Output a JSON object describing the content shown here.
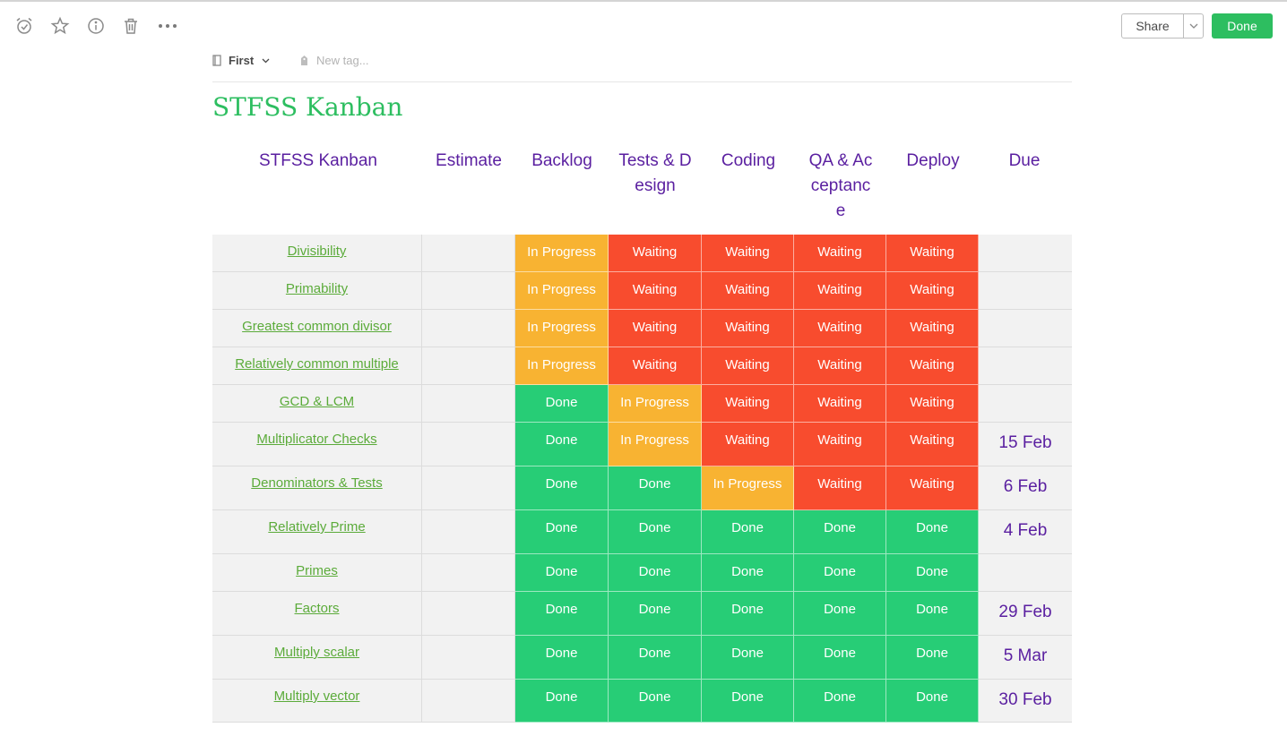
{
  "colors": {
    "in_progress": "#f8b332",
    "waiting": "#f84c2e",
    "done": "#27cd76"
  },
  "toolbar": {
    "icons": [
      "reminder-icon",
      "star-icon",
      "info-icon",
      "trash-icon",
      "more-icon"
    ],
    "share_label": "Share",
    "done_label": "Done"
  },
  "note": {
    "notebook": "First",
    "tag_placeholder": "New tag...",
    "title": "STFSS Kanban"
  },
  "table": {
    "headers": [
      "STFSS Kanban",
      "Estimate",
      "Backlog",
      "Tests & Design",
      "Coding",
      "QA & Acceptance",
      "Deploy",
      "Due"
    ],
    "rows": [
      {
        "topic": "Divisibility",
        "estimate": "",
        "stages": [
          "In Progress",
          "Waiting",
          "Waiting",
          "Waiting",
          "Waiting"
        ],
        "due": ""
      },
      {
        "topic": "Primability",
        "estimate": "",
        "stages": [
          "In Progress",
          "Waiting",
          "Waiting",
          "Waiting",
          "Waiting"
        ],
        "due": ""
      },
      {
        "topic": "Greatest common divisor",
        "estimate": "",
        "stages": [
          "In Progress",
          "Waiting",
          "Waiting",
          "Waiting",
          "Waiting"
        ],
        "due": ""
      },
      {
        "topic": "Relatively common multiple",
        "estimate": "",
        "stages": [
          "In Progress",
          "Waiting",
          "Waiting",
          "Waiting",
          "Waiting"
        ],
        "due": ""
      },
      {
        "topic": "GCD & LCM",
        "estimate": "",
        "stages": [
          "Done",
          "In Progress",
          "Waiting",
          "Waiting",
          "Waiting"
        ],
        "due": ""
      },
      {
        "topic": "Multiplicator Checks",
        "estimate": "",
        "stages": [
          "Done",
          "In Progress",
          "Waiting",
          "Waiting",
          "Waiting"
        ],
        "due": "15 Feb"
      },
      {
        "topic": "Denominators & Tests",
        "estimate": "",
        "stages": [
          "Done",
          "Done",
          "In Progress",
          "Waiting",
          "Waiting"
        ],
        "due": "6 Feb"
      },
      {
        "topic": "Relatively Prime",
        "estimate": "",
        "stages": [
          "Done",
          "Done",
          "Done",
          "Done",
          "Done"
        ],
        "due": "4 Feb"
      },
      {
        "topic": "Primes",
        "estimate": "",
        "stages": [
          "Done",
          "Done",
          "Done",
          "Done",
          "Done"
        ],
        "due": ""
      },
      {
        "topic": "Factors",
        "estimate": "",
        "stages": [
          "Done",
          "Done",
          "Done",
          "Done",
          "Done"
        ],
        "due": "29 Feb"
      },
      {
        "topic": "Multiply scalar",
        "estimate": "",
        "stages": [
          "Done",
          "Done",
          "Done",
          "Done",
          "Done"
        ],
        "due": "5 Mar"
      },
      {
        "topic": "Multiply vector",
        "estimate": "",
        "stages": [
          "Done",
          "Done",
          "Done",
          "Done",
          "Done"
        ],
        "due": "30 Feb"
      }
    ]
  }
}
